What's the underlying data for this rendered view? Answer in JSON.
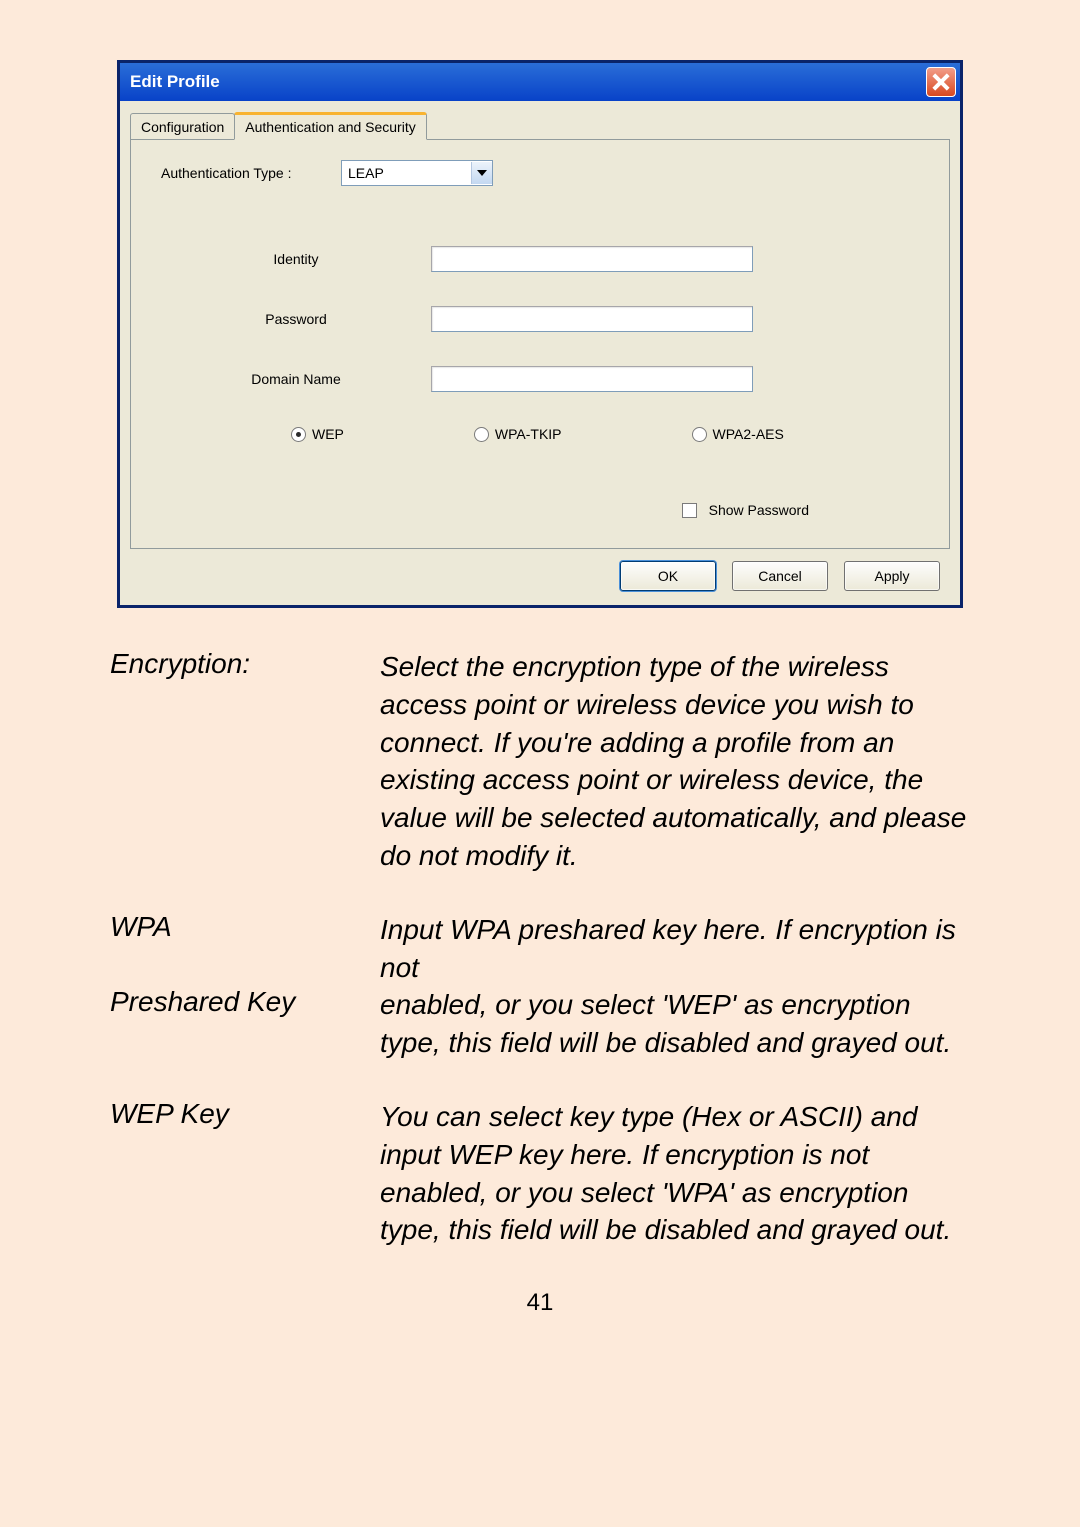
{
  "dialog": {
    "title": "Edit Profile",
    "tabs": {
      "config": "Configuration",
      "auth": "Authentication and Security"
    },
    "authTypeLabel": "Authentication Type :",
    "authTypeValue": "LEAP",
    "identityLabel": "Identity",
    "passwordLabel": "Password",
    "domainLabel": "Domain Name",
    "radios": {
      "wep": "WEP",
      "wpaTkip": "WPA-TKIP",
      "wpa2Aes": "WPA2-AES"
    },
    "showPassword": "Show Password",
    "buttons": {
      "ok": "OK",
      "cancel": "Cancel",
      "apply": "Apply"
    }
  },
  "definitions": {
    "encryption": {
      "term": "Encryption:",
      "desc": "Select the encryption type of the wireless access point or wireless device you wish to connect. If you're adding a profile from an existing access point or wireless device, the value will be selected automatically, and please do not modify it."
    },
    "wpa": {
      "term": "WPA",
      "desc": "Input WPA preshared key here. If encryption is not"
    },
    "preshared": {
      "term": "Preshared Key",
      "desc": "enabled, or you select 'WEP' as encryption type, this field will be disabled and grayed out."
    },
    "wep": {
      "term": "WEP Key",
      "desc": "You can select key type (Hex or ASCII) and input WEP key here. If encryption is not enabled, or you select 'WPA' as encryption type, this field will be disabled and grayed out."
    }
  },
  "pageNumber": "41"
}
